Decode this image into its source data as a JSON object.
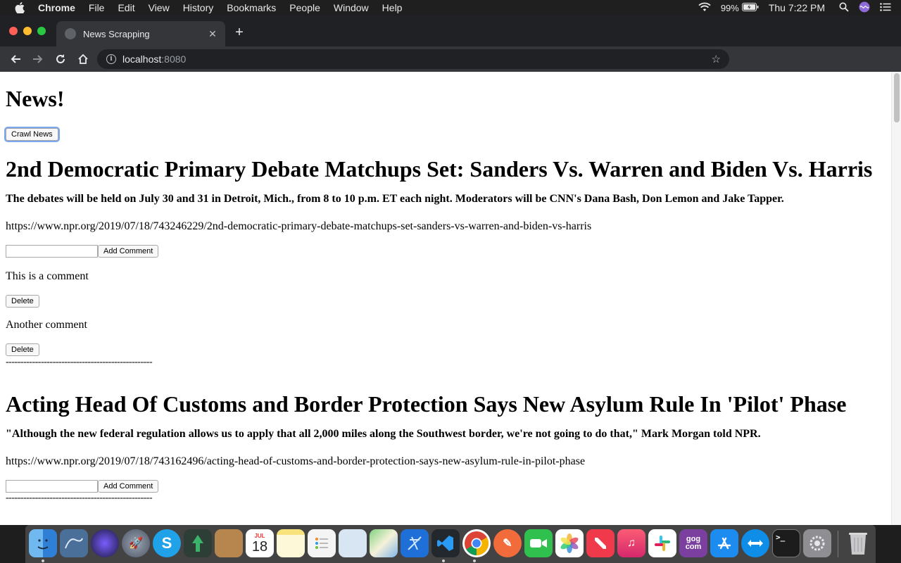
{
  "menubar": {
    "app_name": "Chrome",
    "items": [
      "File",
      "Edit",
      "View",
      "History",
      "Bookmarks",
      "People",
      "Window",
      "Help"
    ],
    "battery": "99%",
    "clock": "Thu 7:22 PM"
  },
  "browser": {
    "tab_title": "News Scrapping",
    "url_host": "localhost",
    "url_port": ":8080"
  },
  "page": {
    "heading": "News!",
    "crawl_button": "Crawl News",
    "articles": [
      {
        "title": "2nd Democratic Primary Debate Matchups Set: Sanders Vs. Warren and Biden Vs. Harris",
        "summary": "The debates will be held on July 30 and 31 in Detroit, Mich., from 8 to 10 p.m. ET each night. Moderators will be CNN's Dana Bash, Don Lemon and Jake Tapper.",
        "url": "https://www.npr.org/2019/07/18/743246229/2nd-democratic-primary-debate-matchups-set-sanders-vs-warren-and-biden-vs-harris",
        "add_comment_label": "Add Comment",
        "comments": [
          {
            "text": "This is a comment",
            "delete_label": "Delete"
          },
          {
            "text": "Another comment",
            "delete_label": "Delete"
          }
        ],
        "separator": "--------------------------------------------------"
      },
      {
        "title": "Acting Head Of Customs and Border Protection Says New Asylum Rule In 'Pilot' Phase",
        "summary": "\"Although the new federal regulation allows us to apply that all 2,000 miles along the Southwest border, we're not going to do that,\" Mark Morgan told NPR.",
        "url": "https://www.npr.org/2019/07/18/743162496/acting-head-of-customs-and-border-protection-says-new-asylum-rule-in-pilot-phase",
        "add_comment_label": "Add Comment",
        "separator": "--------------------------------------------------"
      }
    ]
  },
  "dock": {
    "calendar_month": "JUL",
    "calendar_day": "18",
    "gog_label": "gog com"
  }
}
